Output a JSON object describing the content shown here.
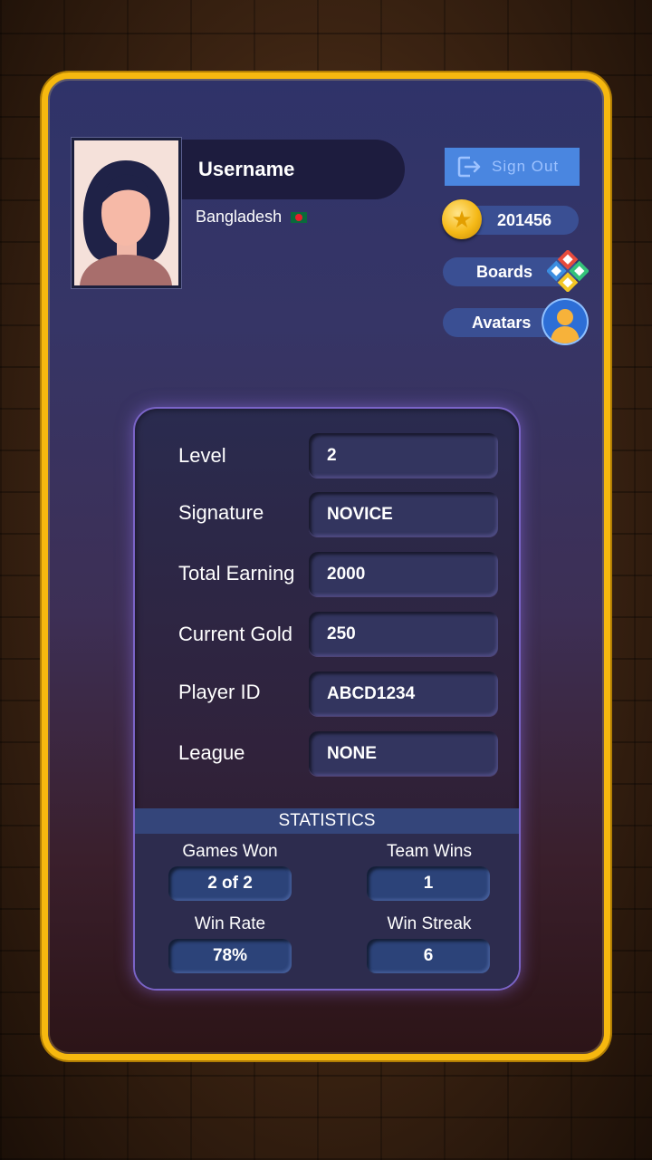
{
  "profile": {
    "username": "Username",
    "country": "Bangladesh",
    "flag_icon": "bangladesh-flag-icon"
  },
  "actions": {
    "sign_out_label": "Sign Out",
    "coins": "201456",
    "boards_label": "Boards",
    "avatars_label": "Avatars"
  },
  "details": [
    {
      "label": "Level",
      "value": "2"
    },
    {
      "label": "Signature",
      "value": "NOVICE"
    },
    {
      "label": "Total Earning",
      "value": "2000"
    },
    {
      "label": "Current Gold",
      "value": "250"
    },
    {
      "label": "Player ID",
      "value": "ABCD1234"
    },
    {
      "label": "League",
      "value": "NONE"
    }
  ],
  "statistics": {
    "title": "STATISTICS",
    "items": [
      {
        "label": "Games Won",
        "value": "2 of 2"
      },
      {
        "label": "Team Wins",
        "value": "1"
      },
      {
        "label": "Win Rate",
        "value": "78%"
      },
      {
        "label": "Win Streak",
        "value": "6"
      }
    ]
  },
  "colors": {
    "frame_gold": "#f6b80f",
    "sign_out_blue": "#4a86e0",
    "pill_blue": "#3a4f93",
    "panel_glow": "#7a64c7"
  }
}
